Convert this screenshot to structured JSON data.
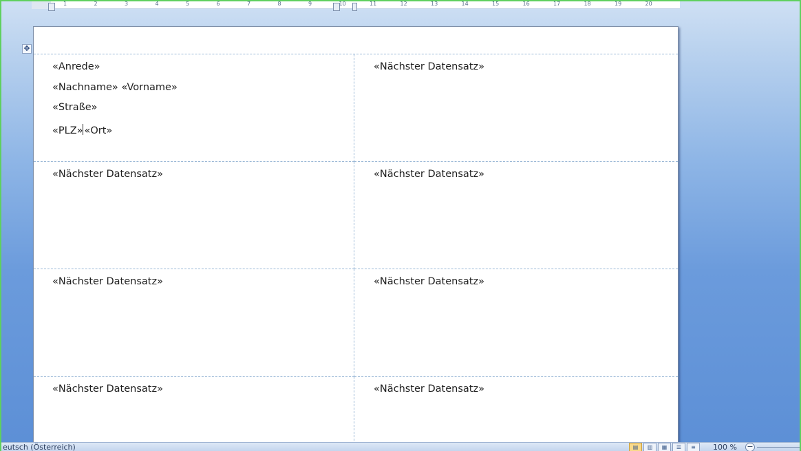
{
  "ruler": {
    "ticks": [
      "1",
      "2",
      "3",
      "4",
      "5",
      "6",
      "7",
      "8",
      "9",
      "10",
      "11",
      "12",
      "13",
      "14",
      "15",
      "16",
      "17",
      "18",
      "19",
      "20"
    ]
  },
  "labels": {
    "first": {
      "anrede": "«Anrede»",
      "name": "«Nachname» «Vorname»",
      "strasse": "«Straße»",
      "plz": "«PLZ»",
      "ort": "«Ort»"
    },
    "next_record": "«Nächster Datensatz»"
  },
  "statusbar": {
    "language": "eutsch (Österreich)",
    "zoom": "100 %",
    "zoom_out": "−"
  },
  "colors": {
    "background_top": "#cfe0f4",
    "background_bottom": "#5c8fd6",
    "gridline": "#9ab8d6"
  }
}
